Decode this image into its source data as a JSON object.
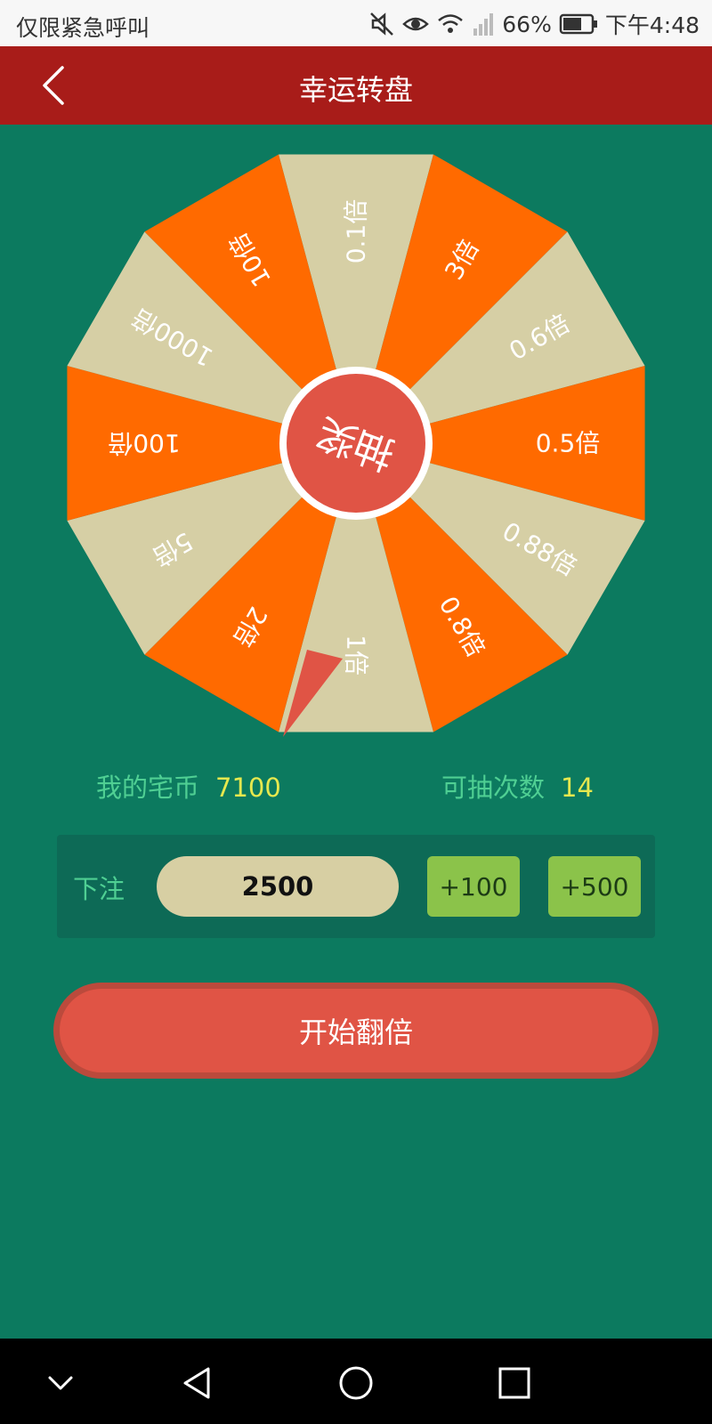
{
  "status_bar": {
    "left_text": "仅限紧急呼叫",
    "battery": "66%",
    "time": "下午4:48"
  },
  "header": {
    "title": "幸运转盘",
    "back_icon": "chevron-left-icon"
  },
  "wheel": {
    "center_label": "抽奖",
    "segments": [
      {
        "label": "0.1倍",
        "color": "#d6cfa5"
      },
      {
        "label": "3倍",
        "color": "#ff6a00"
      },
      {
        "label": "0.6倍",
        "color": "#d6cfa5"
      },
      {
        "label": "0.5倍",
        "color": "#ff6a00"
      },
      {
        "label": "0.88倍",
        "color": "#d6cfa5"
      },
      {
        "label": "0.8倍",
        "color": "#ff6a00"
      },
      {
        "label": "1倍",
        "color": "#d6cfa5"
      },
      {
        "label": "2倍",
        "color": "#ff6a00"
      },
      {
        "label": "5倍",
        "color": "#d6cfa5"
      },
      {
        "label": "100倍",
        "color": "#ff6a00"
      },
      {
        "label": "1000倍",
        "color": "#d6cfa5"
      },
      {
        "label": "10倍",
        "color": "#ff6a00"
      }
    ]
  },
  "stats": {
    "coins_label": "我的宅币",
    "coins_value": "7100",
    "draws_label": "可抽次数",
    "draws_value": "14"
  },
  "bet": {
    "label": "下注",
    "value": "2500",
    "add_100": "+100",
    "add_500": "+500"
  },
  "start_button": "开始翻倍",
  "colors": {
    "background": "#0c7a5f",
    "header": "#a81c19",
    "orange": "#ff6a00",
    "beige": "#d6cfa5",
    "center": "#e05445",
    "green_button": "#8bc34a",
    "label_green": "#4fcf93",
    "value_yellow": "#e6e84e"
  }
}
